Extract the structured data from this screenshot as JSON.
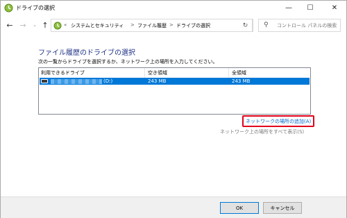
{
  "window": {
    "title": "ドライブの選択",
    "minimize_glyph": "—",
    "maximize_glyph": "☐",
    "close_glyph": "✕"
  },
  "nav": {
    "back_glyph": "←",
    "forward_glyph": "→",
    "dropdown_glyph": "⌄",
    "up_glyph": "↑",
    "crumb_prefix": "«",
    "breadcrumbs": [
      "システムとセキュリティ",
      "ファイル履歴",
      "ドライブの選択"
    ],
    "separator": ">",
    "address_dropdown_glyph": "⌄",
    "refresh_glyph": "↻",
    "search_glyph": "⚲",
    "search_placeholder": "コントロール パネルの検索"
  },
  "main": {
    "title": "ファイル履歴のドライブの選択",
    "instruction": "次の一覧からドライブを選択するか、ネットワーク上の場所を入力してください。",
    "columns": [
      "利用できるドライブ",
      "空き領域",
      "全領域"
    ],
    "rows": [
      {
        "drive_label": "(Dː)",
        "free_space": "243 MB",
        "total_space": "243 MB",
        "selected": true
      }
    ],
    "add_network_link": "ネットワークの場所の追加(A)",
    "show_network_link": "ネットワーク上の場所をすべて表示(S)"
  },
  "footer": {
    "ok_label": "OK",
    "cancel_label": "キャンセル"
  },
  "colors": {
    "accent": "#0078d7",
    "title_blue": "#1e3287",
    "highlight_border": "#e0001b",
    "link": "#0066cc"
  }
}
